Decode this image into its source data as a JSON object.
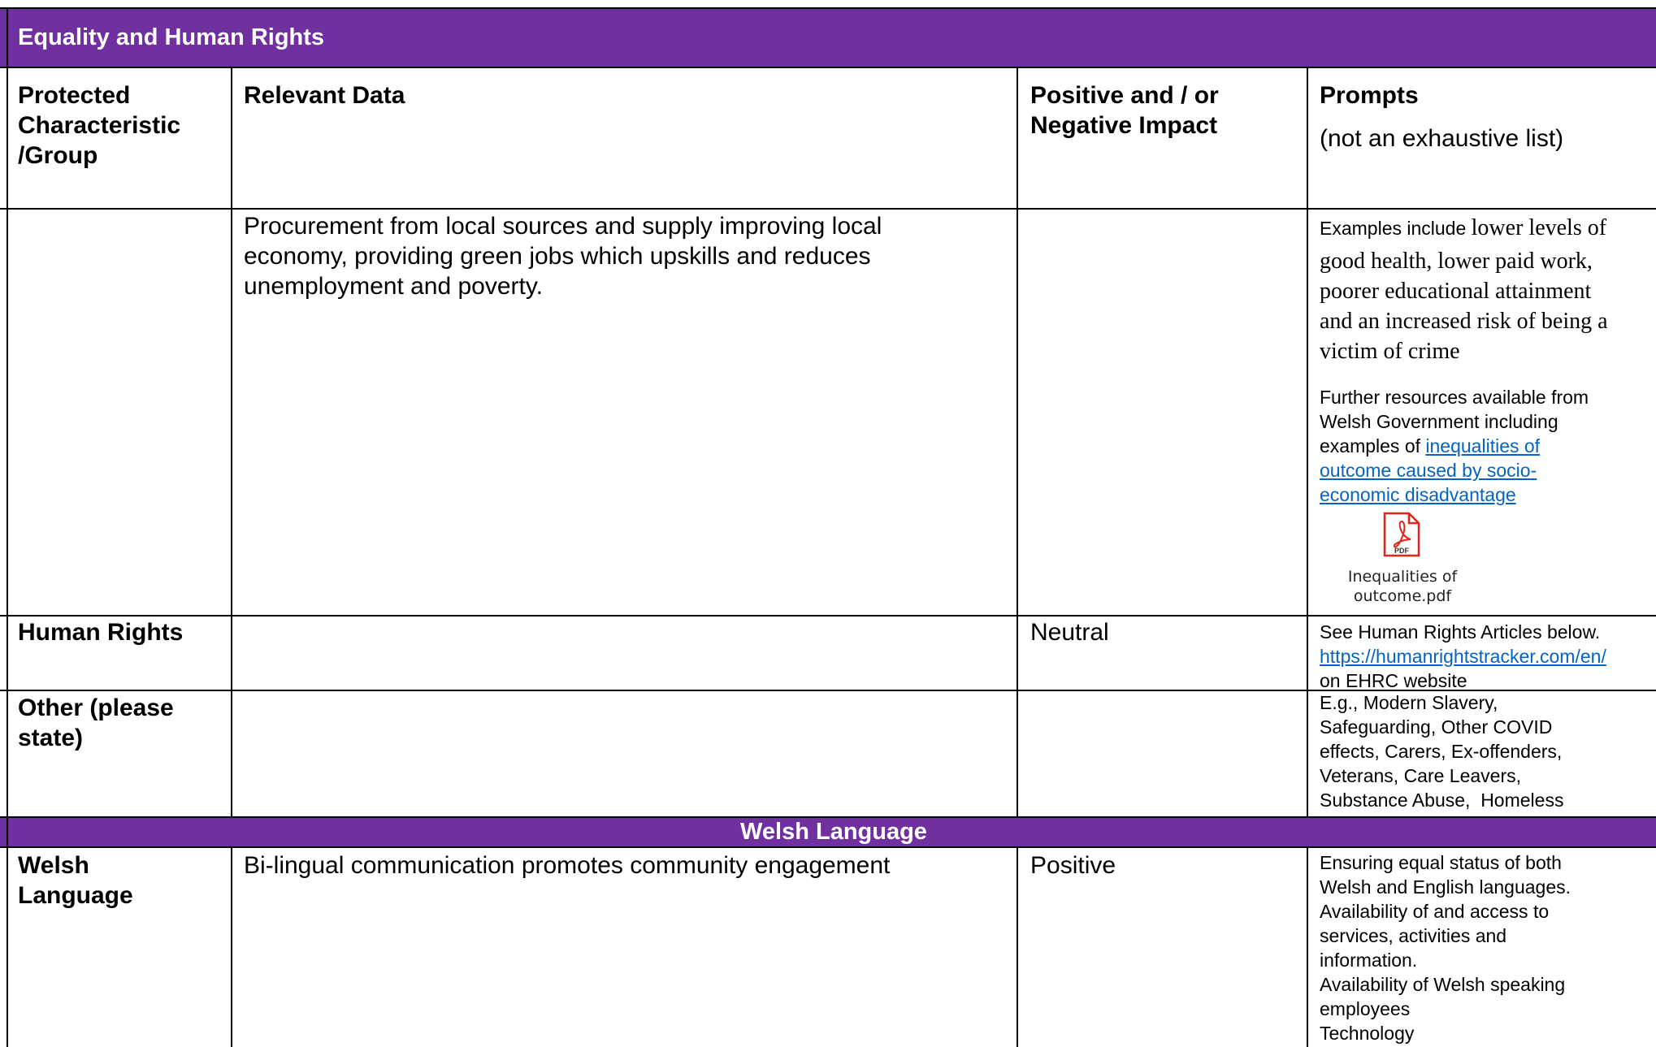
{
  "section_title": "Equality and Human Rights",
  "columns": {
    "col1": [
      "Protected",
      "Characteristic",
      "/Group"
    ],
    "col2": [
      "Relevant Data"
    ],
    "col3": [
      "Positive and / or",
      "Negative Impact"
    ],
    "col4_title": "Prompts",
    "col4_sub": "(not an exhaustive list)"
  },
  "socio_row": {
    "group": "",
    "data_lines": [
      "Procurement from local sources and supply improving local",
      "economy, providing green jobs which upskills and reduces",
      "unemployment and poverty."
    ],
    "impact": "",
    "prompt_lead": "Examples include ",
    "prompt_serif_first": "lower levels of",
    "prompt_serif_lines": [
      "good health, lower paid work,",
      "poorer educational attainment",
      "and an increased risk of being a",
      "victim of crime"
    ],
    "resources_lines": [
      "Further resources available from",
      "Welsh Government including"
    ],
    "resources_prefix": "examples of ",
    "link_lines": [
      "inequalities of",
      "outcome caused by socio-",
      "economic disadvantage"
    ],
    "attachment_icon": "pdf-file-icon",
    "attachment_icon_label": "PDF",
    "attachment_name_lines": [
      "Inequalities of",
      "outcome.pdf"
    ]
  },
  "human_rights_row": {
    "group": "Human Rights",
    "data": "",
    "impact": "Neutral",
    "prompt_line1": "See Human Rights Articles below.",
    "prompt_link": "https://humanrightstracker.com/en/",
    "prompt_line3": "on EHRC website"
  },
  "other_row": {
    "group_lines": [
      "Other (please",
      "state)"
    ],
    "data": "",
    "impact": "",
    "prompt_lines": [
      "E.g., Modern Slavery,",
      "Safeguarding, Other COVID",
      "effects, Carers, Ex-offenders,",
      "Veterans, Care Leavers,",
      "Substance Abuse,  Homeless"
    ]
  },
  "welsh_band_title": "Welsh Language",
  "welsh_row": {
    "group_lines": [
      "Welsh",
      "Language"
    ],
    "data": "Bi-lingual communication promotes community engagement",
    "impact": "Positive",
    "prompt_lines": [
      "Ensuring equal status of both",
      "Welsh and English languages.",
      "Availability of and access to",
      "services, activities and",
      "information.",
      "Availability of Welsh speaking",
      "employees",
      "Technology"
    ]
  },
  "colors": {
    "header_band": "#7030a0",
    "link": "#0563c1",
    "pdf_red": "#e1251b"
  }
}
